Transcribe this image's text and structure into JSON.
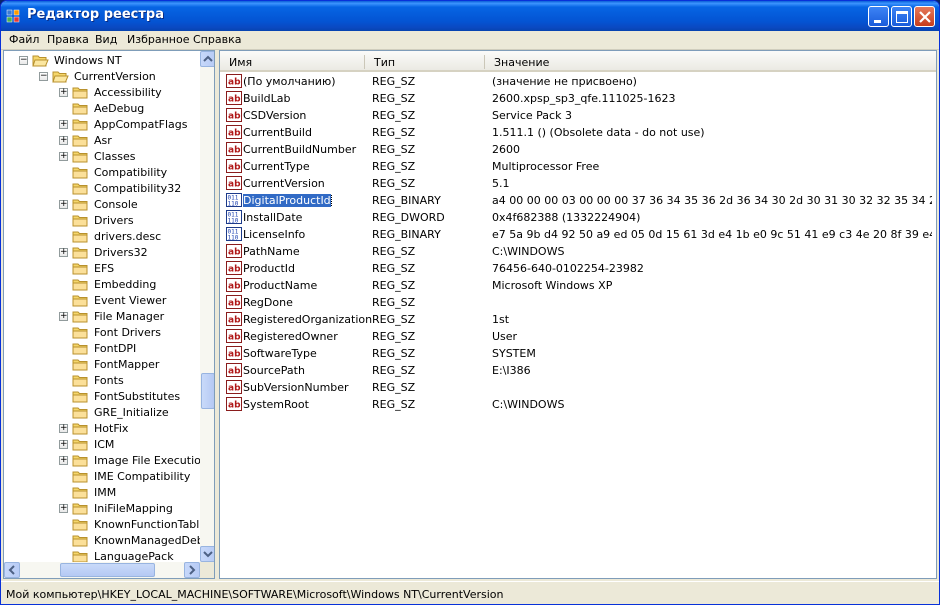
{
  "window": {
    "title": "Редактор реестра"
  },
  "menu": [
    "Файл",
    "Правка",
    "Вид",
    "Избранное",
    "Справка"
  ],
  "tree": {
    "parent": "Windows NT",
    "current": "CurrentVersion",
    "children": [
      {
        "label": "Accessibility",
        "expandable": true
      },
      {
        "label": "AeDebug",
        "expandable": false
      },
      {
        "label": "AppCompatFlags",
        "expandable": true
      },
      {
        "label": "Asr",
        "expandable": true
      },
      {
        "label": "Classes",
        "expandable": true
      },
      {
        "label": "Compatibility",
        "expandable": false
      },
      {
        "label": "Compatibility32",
        "expandable": false
      },
      {
        "label": "Console",
        "expandable": true
      },
      {
        "label": "Drivers",
        "expandable": false
      },
      {
        "label": "drivers.desc",
        "expandable": false
      },
      {
        "label": "Drivers32",
        "expandable": true
      },
      {
        "label": "EFS",
        "expandable": false
      },
      {
        "label": "Embedding",
        "expandable": false
      },
      {
        "label": "Event Viewer",
        "expandable": false
      },
      {
        "label": "File Manager",
        "expandable": true
      },
      {
        "label": "Font Drivers",
        "expandable": false
      },
      {
        "label": "FontDPI",
        "expandable": false
      },
      {
        "label": "FontMapper",
        "expandable": false
      },
      {
        "label": "Fonts",
        "expandable": false
      },
      {
        "label": "FontSubstitutes",
        "expandable": false
      },
      {
        "label": "GRE_Initialize",
        "expandable": false
      },
      {
        "label": "HotFix",
        "expandable": true
      },
      {
        "label": "ICM",
        "expandable": true
      },
      {
        "label": "Image File Execution Options",
        "expandable": true
      },
      {
        "label": "IME Compatibility",
        "expandable": false
      },
      {
        "label": "IMM",
        "expandable": false
      },
      {
        "label": "IniFileMapping",
        "expandable": true
      },
      {
        "label": "KnownFunctionTableDlls",
        "expandable": false
      },
      {
        "label": "KnownManagedDebuggingDlls",
        "expandable": false
      },
      {
        "label": "LanguagePack",
        "expandable": false
      }
    ]
  },
  "columns": {
    "name": "Имя",
    "type": "Тип",
    "data": "Значение"
  },
  "values": [
    {
      "icon": "ab",
      "name": "(По умолчанию)",
      "type": "REG_SZ",
      "data": "(значение не присвоено)"
    },
    {
      "icon": "ab",
      "name": "BuildLab",
      "type": "REG_SZ",
      "data": "2600.xpsp_sp3_qfe.111025-1623"
    },
    {
      "icon": "ab",
      "name": "CSDVersion",
      "type": "REG_SZ",
      "data": "Service Pack 3"
    },
    {
      "icon": "ab",
      "name": "CurrentBuild",
      "type": "REG_SZ",
      "data": "1.511.1 () (Obsolete data - do not use)"
    },
    {
      "icon": "ab",
      "name": "CurrentBuildNumber",
      "type": "REG_SZ",
      "data": "2600"
    },
    {
      "icon": "ab",
      "name": "CurrentType",
      "type": "REG_SZ",
      "data": "Multiprocessor Free"
    },
    {
      "icon": "ab",
      "name": "CurrentVersion",
      "type": "REG_SZ",
      "data": "5.1"
    },
    {
      "icon": "bin",
      "name": "DigitalProductId",
      "type": "REG_BINARY",
      "data": "a4 00 00 00 03 00 00 00 37 36 34 35 36 2d 36 34 30 2d 30 31 30 32 32 35 34 2d 32 3...",
      "selected": true
    },
    {
      "icon": "bin",
      "name": "InstallDate",
      "type": "REG_DWORD",
      "data": "0x4f682388 (1332224904)"
    },
    {
      "icon": "bin",
      "name": "LicenseInfo",
      "type": "REG_BINARY",
      "data": "e7 5a 9b d4 92 50 a9 ed 05 0d 15 61 3d e4 1b e0 9c 51 41 e9 c3 4e 20 8f 39 e4 46 1b ..."
    },
    {
      "icon": "ab",
      "name": "PathName",
      "type": "REG_SZ",
      "data": "C:\\WINDOWS"
    },
    {
      "icon": "ab",
      "name": "ProductId",
      "type": "REG_SZ",
      "data": "76456-640-0102254-23982"
    },
    {
      "icon": "ab",
      "name": "ProductName",
      "type": "REG_SZ",
      "data": "Microsoft Windows XP"
    },
    {
      "icon": "ab",
      "name": "RegDone",
      "type": "REG_SZ",
      "data": ""
    },
    {
      "icon": "ab",
      "name": "RegisteredOrganization",
      "type": "REG_SZ",
      "data": "1st"
    },
    {
      "icon": "ab",
      "name": "RegisteredOwner",
      "type": "REG_SZ",
      "data": "User"
    },
    {
      "icon": "ab",
      "name": "SoftwareType",
      "type": "REG_SZ",
      "data": "SYSTEM"
    },
    {
      "icon": "ab",
      "name": "SourcePath",
      "type": "REG_SZ",
      "data": "E:\\I386"
    },
    {
      "icon": "ab",
      "name": "SubVersionNumber",
      "type": "REG_SZ",
      "data": ""
    },
    {
      "icon": "ab",
      "name": "SystemRoot",
      "type": "REG_SZ",
      "data": "C:\\WINDOWS"
    }
  ],
  "status": {
    "path": "Мой компьютер\\HKEY_LOCAL_MACHINE\\SOFTWARE\\Microsoft\\Windows NT\\CurrentVersion"
  },
  "colors": {
    "titlebar": "#0453d2",
    "selection": "#316ac5",
    "chrome": "#ece9d8",
    "pane_border": "#7f9db9"
  }
}
